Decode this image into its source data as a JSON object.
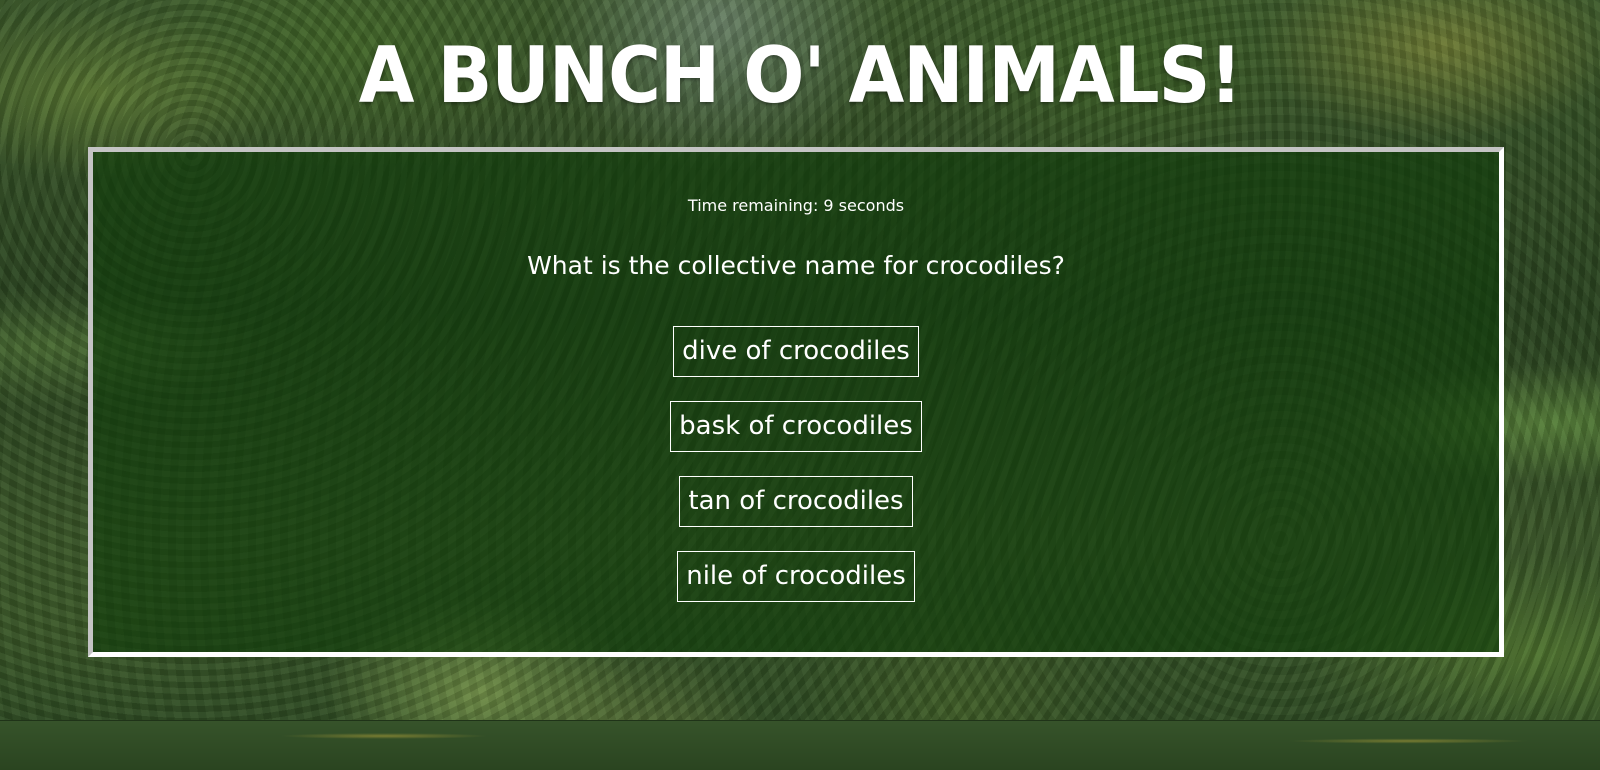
{
  "page": {
    "title": "A BUNCH O' ANIMALS!"
  },
  "quiz": {
    "timer_text": "Time remaining: 9 seconds",
    "question": "What is the collective name for crocodiles?",
    "answers": [
      "dive of crocodiles",
      "bask of crocodiles",
      "tan of crocodiles",
      "nile of crocodiles"
    ]
  },
  "colors": {
    "text": "#ffffff",
    "panel_overlay": "#0f3c0a",
    "panel_border": "#c4c4c4"
  }
}
